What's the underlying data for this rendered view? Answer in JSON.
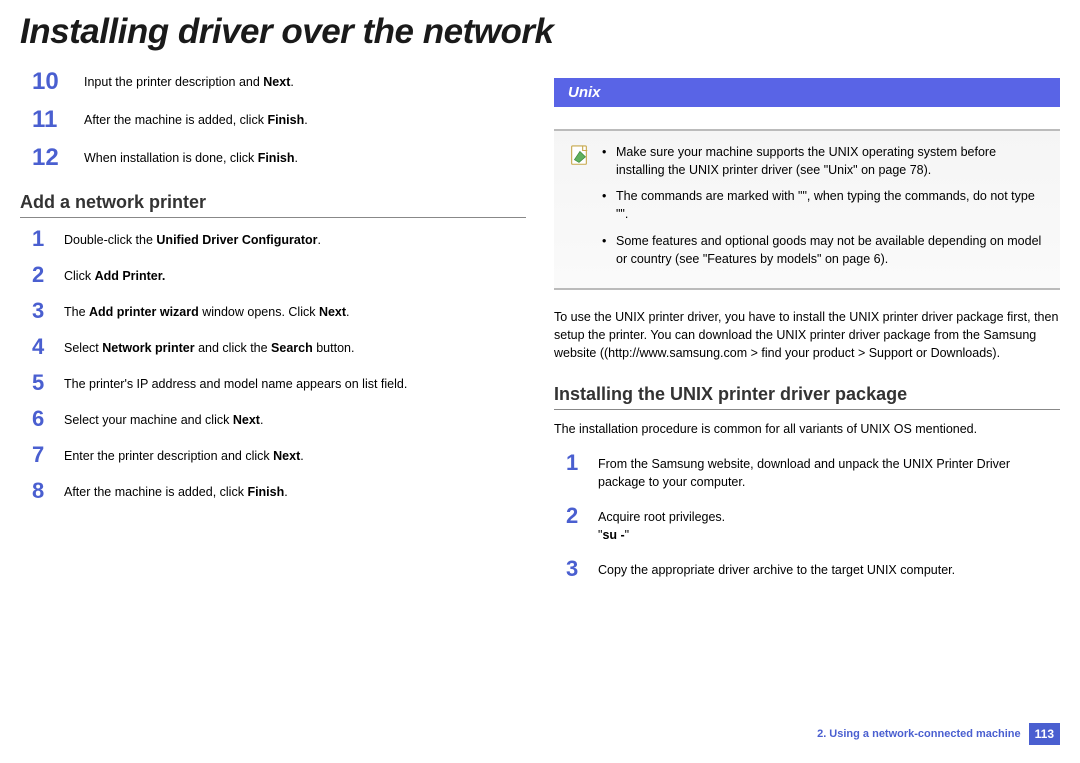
{
  "title": "Installing driver over the network",
  "left": {
    "continuedSteps": [
      {
        "num": "10",
        "html": "Input the printer description and <b>Next</b>."
      },
      {
        "num": "11",
        "html": "After the machine is added, click <b>Finish</b>."
      },
      {
        "num": "12",
        "html": "When installation is done, click <b>Finish</b>."
      }
    ],
    "subheading": "Add a network printer",
    "steps": [
      {
        "num": "1",
        "html": "Double-click the <b>Unified Driver Configurator</b>."
      },
      {
        "num": "2",
        "html": "Click <b>Add Printer.</b>"
      },
      {
        "num": "3",
        "html": "The <b>Add printer wizard</b> window opens. Click <b>Next</b>."
      },
      {
        "num": "4",
        "html": "Select <b>Network printer</b> and click the <b>Search</b> button."
      },
      {
        "num": "5",
        "html": "The printer's IP address and model name appears on list field."
      },
      {
        "num": "6",
        "html": "Select your machine and click <b>Next</b>."
      },
      {
        "num": "7",
        "html": "Enter the printer description and click <b>Next</b>."
      },
      {
        "num": "8",
        "html": "After the machine is added, click <b>Finish</b>."
      }
    ]
  },
  "right": {
    "sectionBar": "Unix",
    "notes": [
      "Make sure your machine supports the UNIX operating system before installing the UNIX printer driver (see \"Unix\" on page 78).",
      "The commands are marked with \"\", when typing the commands, do not type \"\".",
      "Some features and optional goods may not be available depending on model or country (see \"Features by models\" on page 6)."
    ],
    "para1": "To use the UNIX printer driver, you have to install the UNIX printer driver package first, then setup the printer. You can download the UNIX printer driver package from the Samsung website ((http://www.samsung.com > find your product > Support or Downloads).",
    "subheading": "Installing the UNIX printer driver package",
    "para2": "The installation procedure is common for all variants of UNIX OS mentioned.",
    "steps": [
      {
        "num": "1",
        "html": "From the Samsung website, download and unpack the UNIX Printer Driver package to your computer."
      },
      {
        "num": "2",
        "html": "Acquire root privileges.<br>\"<b>su -</b>\""
      },
      {
        "num": "3",
        "html": "Copy the appropriate driver archive to the target UNIX computer."
      }
    ]
  },
  "footer": {
    "chapter": "2.  Using a network-connected machine",
    "page": "113"
  }
}
